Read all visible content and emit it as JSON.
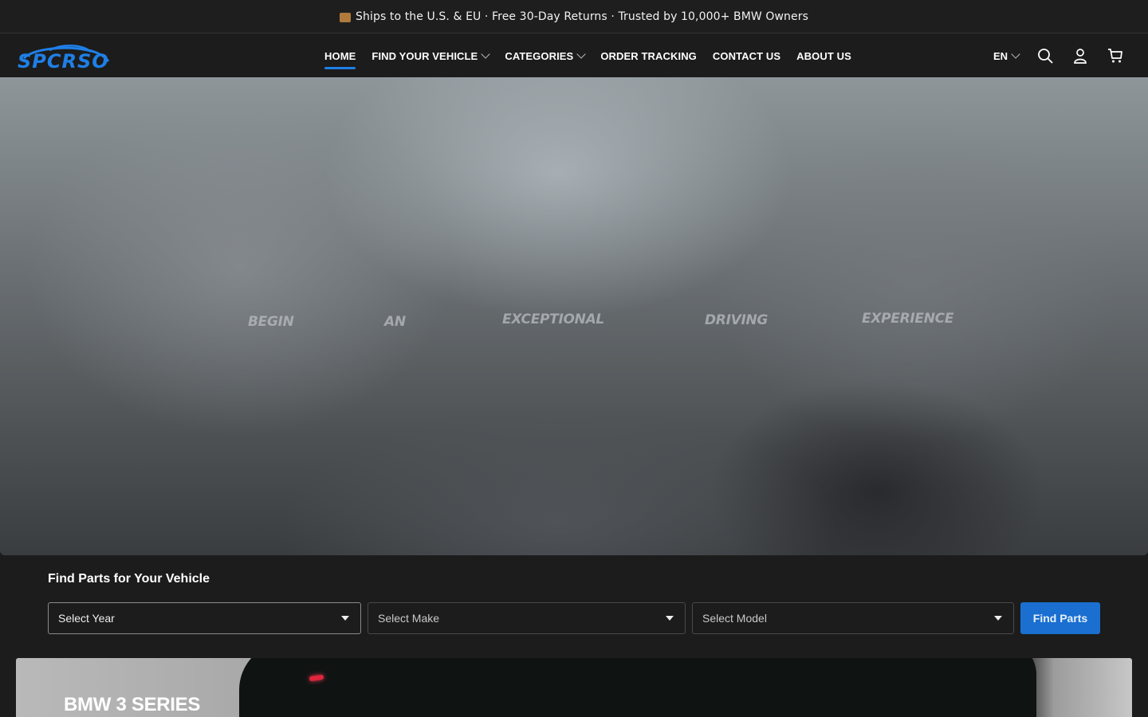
{
  "announcement": {
    "text": "Ships to the U.S. & EU · Free 30-Day Returns · Trusted by 10,000+ BMW Owners",
    "icon": "package-icon"
  },
  "header": {
    "logo_text": "SPCRSO",
    "nav": [
      {
        "label": "HOME",
        "active": true,
        "dropdown": false
      },
      {
        "label": "FIND YOUR VEHICLE",
        "active": false,
        "dropdown": true
      },
      {
        "label": "CATEGORIES",
        "active": false,
        "dropdown": true
      },
      {
        "label": "ORDER TRACKING",
        "active": false,
        "dropdown": false
      },
      {
        "label": "CONTACT US",
        "active": false,
        "dropdown": false
      },
      {
        "label": "ABOUT US",
        "active": false,
        "dropdown": false
      }
    ],
    "language": "EN",
    "icons": [
      "search-icon",
      "account-icon",
      "cart-icon"
    ]
  },
  "hero": {
    "words": [
      "BEGIN",
      "AN",
      "EXCEPTIONAL",
      "DRIVING",
      "EXPERIENCE"
    ]
  },
  "finder": {
    "title": "Find Parts for Your Vehicle",
    "year_placeholder": "Select Year",
    "make_placeholder": "Select Make",
    "model_placeholder": "Select Model",
    "button_label": "Find Parts"
  },
  "series": {
    "title": "BMW 3 SERIES"
  },
  "colors": {
    "accent": "#1f7fe6",
    "button": "#1a6fd0",
    "background": "#1c1c1c"
  }
}
